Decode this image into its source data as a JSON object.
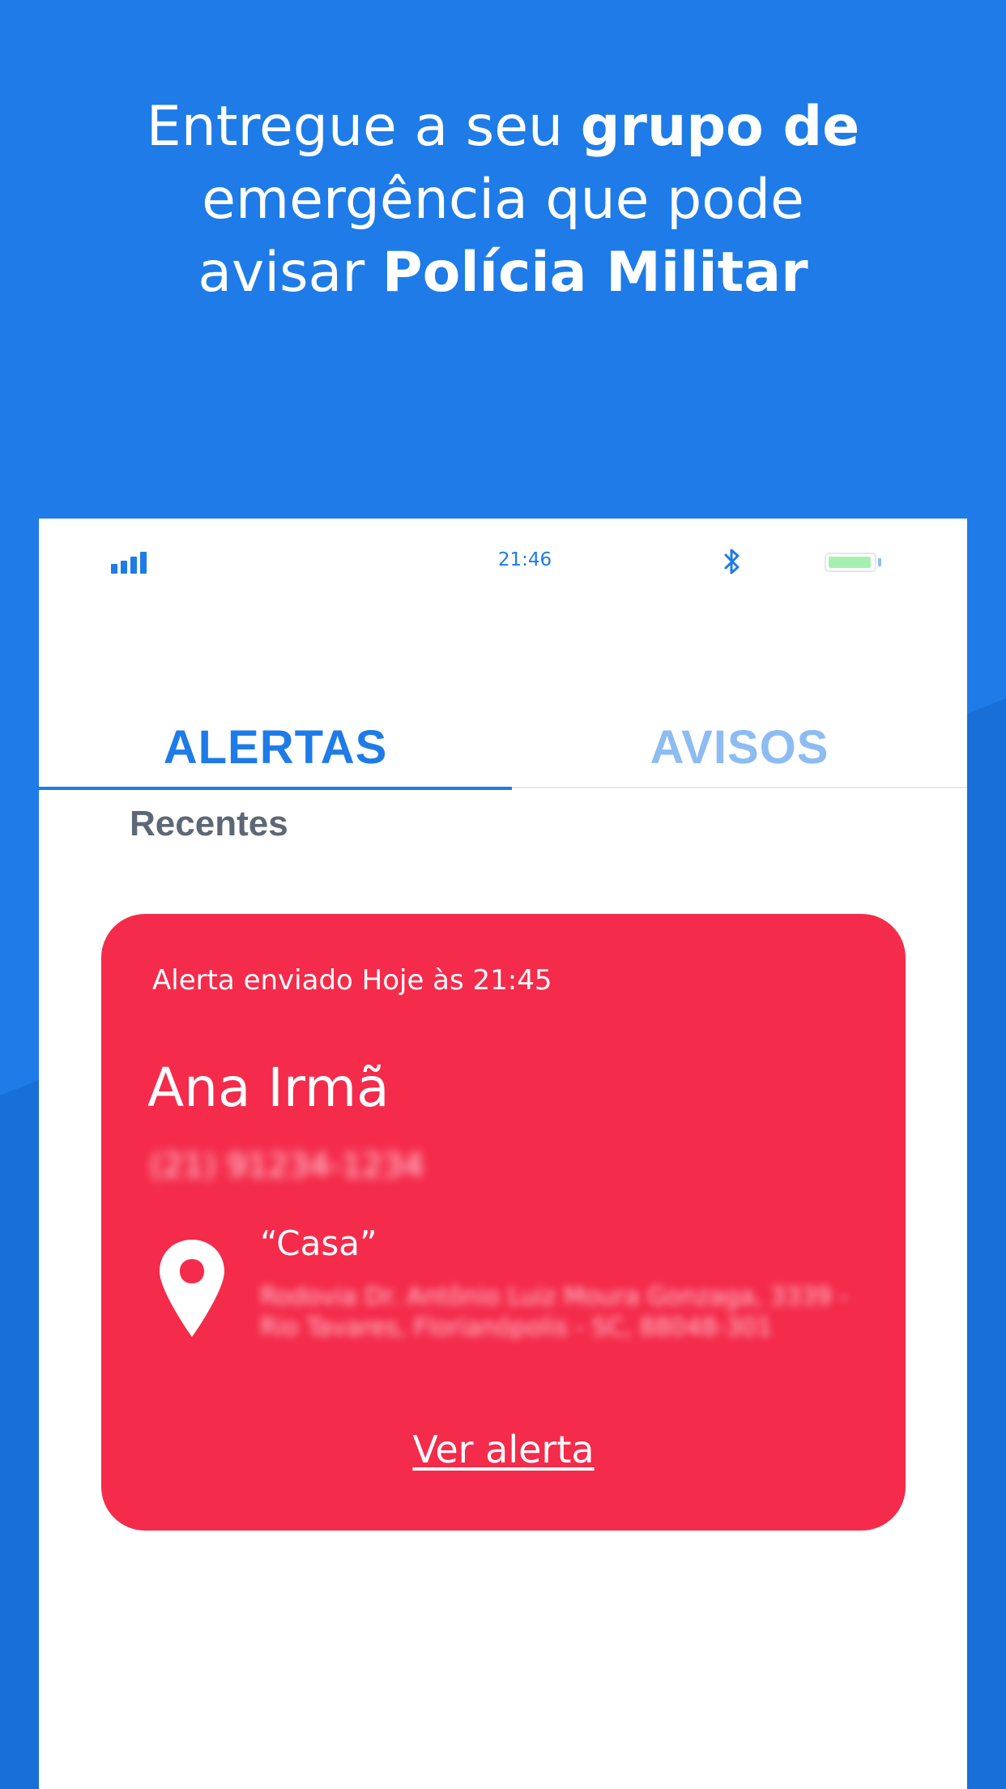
{
  "headline": {
    "line1_normal": "Entregue a seu ",
    "line1_bold": "grupo de",
    "line2_normal": "emergência que pode",
    "line3_normal": "avisar ",
    "line3_bold": "Polícia Militar"
  },
  "status_bar": {
    "time": "21:46",
    "icons": [
      "signal-icon",
      "bluetooth-icon",
      "battery-icon"
    ]
  },
  "tabs": [
    {
      "label": "ALERTAS",
      "active": true
    },
    {
      "label": "AVISOS",
      "active": false
    }
  ],
  "section_title": "Recentes",
  "alert_card": {
    "sent_text": "Alerta enviado Hoje às 21:45",
    "name": "Ana Irmã",
    "phone": "(21) 91234-1234",
    "place_label": "“Casa”",
    "address": "Rodovia Dr. Antônio Luiz Moura Gonzaga, 3339 - Rio Tavares, Florianópolis - SC, 88048-301",
    "link_label": "Ver alerta",
    "icon": "location-pin-icon"
  },
  "colors": {
    "background": "#1e7be8",
    "accent": "#1e7be8",
    "tab_inactive": "#8dbcf2",
    "alert_card": "#f42b4b",
    "section_title": "#5d6775",
    "battery": "#a6f0b0"
  }
}
